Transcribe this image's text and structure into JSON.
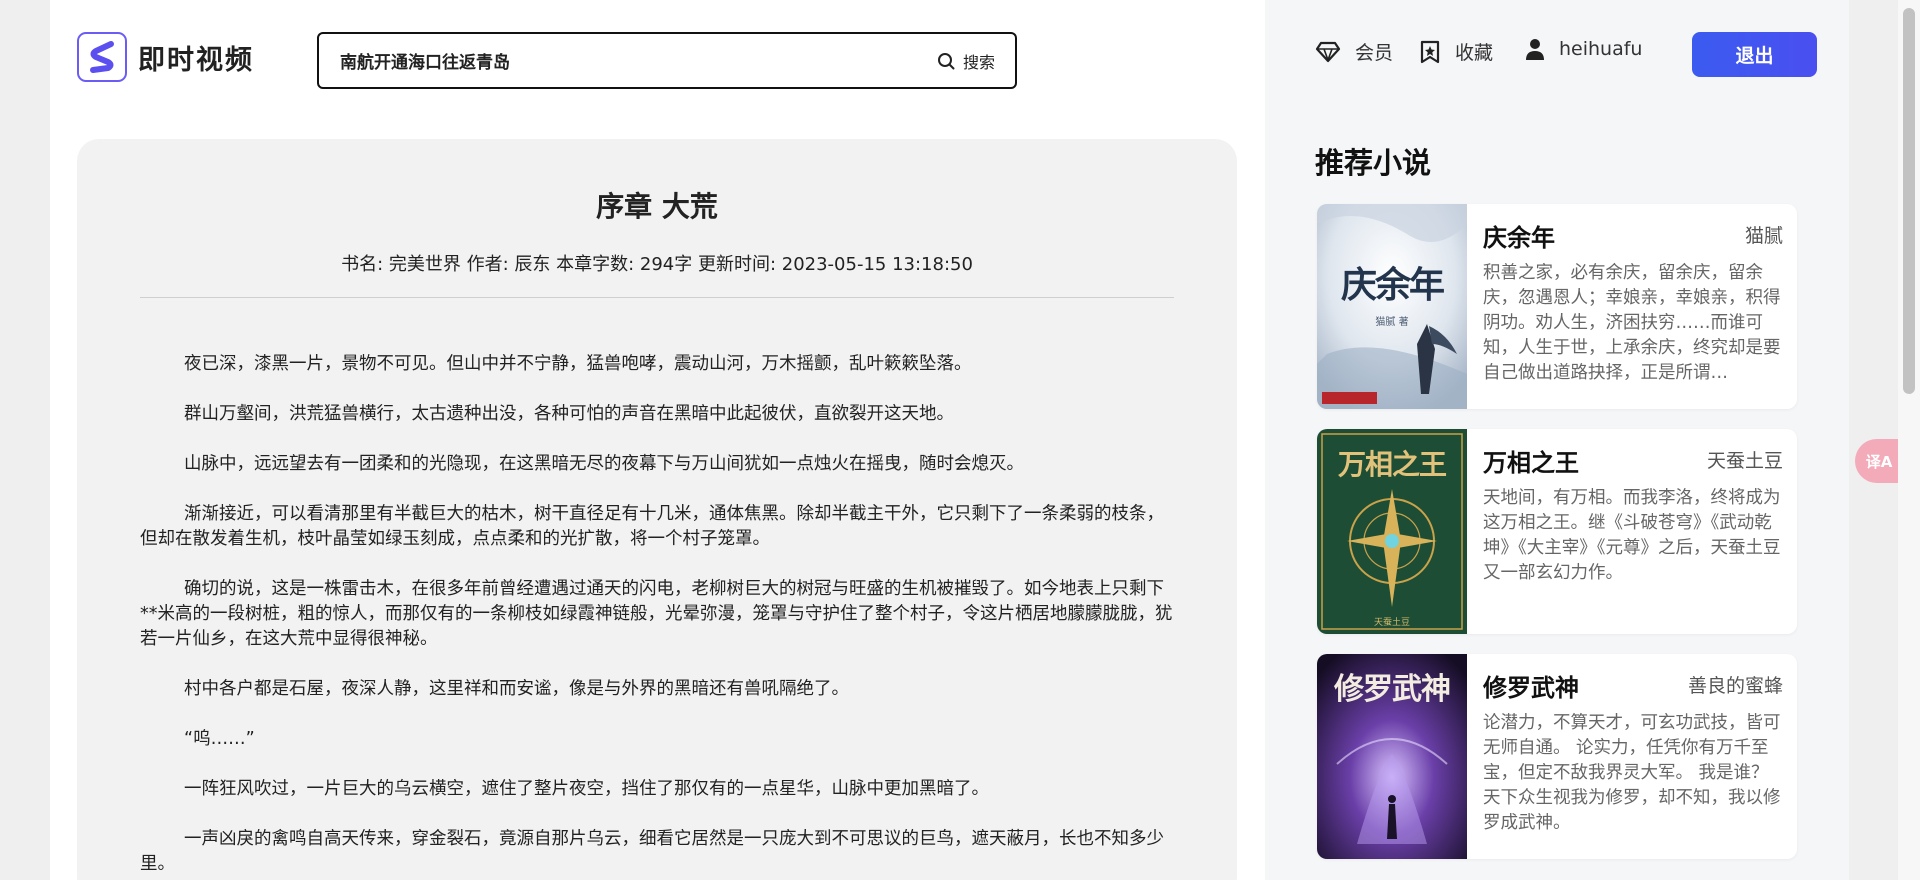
{
  "brand": {
    "name": "即时视频",
    "accent": "#6b5cf6"
  },
  "search": {
    "value": "南航开通海口往返青岛",
    "button_label": "搜索"
  },
  "header": {
    "vip_label": "会员",
    "favorites_label": "收藏",
    "username": "heihuafu",
    "logout_label": "退出"
  },
  "article": {
    "title": "序章 大荒",
    "meta": "书名: 完美世界 作者: 辰东 本章字数: 294字 更新时间: 2023-05-15 13:18:50",
    "paragraphs": [
      "夜已深，漆黑一片，景物不可见。但山中并不宁静，猛兽咆哮，震动山河，万木摇颤，乱叶簌簌坠落。",
      "群山万壑间，洪荒猛兽横行，太古遗种出没，各种可怕的声音在黑暗中此起彼伏，直欲裂开这天地。",
      "山脉中，远远望去有一团柔和的光隐现，在这黑暗无尽的夜幕下与万山间犹如一点烛火在摇曳，随时会熄灭。",
      "渐渐接近，可以看清那里有半截巨大的枯木，树干直径足有十几米，通体焦黑。除却半截主干外，它只剩下了一条柔弱的枝条，但却在散发着生机，枝叶晶莹如绿玉刻成，点点柔和的光扩散，将一个村子笼罩。",
      "确切的说，这是一株雷击木，在很多年前曾经遭遇过通天的闪电，老柳树巨大的树冠与旺盛的生机被摧毁了。如今地表上只剩下**米高的一段树桩，粗的惊人，而那仅有的一条柳枝如绿霞神链般，光晕弥漫，笼罩与守护住了整个村子，令这片栖居地朦朦胧胧，犹若一片仙乡，在这大荒中显得很神秘。",
      "村中各户都是石屋，夜深人静，这里祥和而安谧，像是与外界的黑暗还有兽吼隔绝了。",
      "“呜……”",
      "一阵狂风吹过，一片巨大的乌云横空，遮住了整片夜空，挡住了那仅有的一点星华，山脉中更加黑暗了。",
      "一声凶戾的禽鸣自高天传来，穿金裂石，竟源自那片乌云，细看它居然是一只庞大到不可思议的巨鸟，遮天蔽月，长也不知多少里。"
    ]
  },
  "recommend": {
    "title": "推荐小说",
    "books": [
      {
        "name": "庆余年",
        "author": "猫腻",
        "desc": "积善之家，必有余庆，留余庆，留余庆，忽遇恩人；幸娘亲，幸娘亲，积得阴功。劝人生，济困扶穷……而谁可知，人生于世，上承余庆，终究却是要自己做出道路抉择，正是所谓…",
        "cover_text": "庆余年",
        "cover_sub": "猫腻 著"
      },
      {
        "name": "万相之王",
        "author": "天蚕土豆",
        "desc": "天地间，有万相。而我李洛，终将成为这万相之王。继《斗破苍穹》《武动乾坤》《大主宰》《元尊》之后，天蚕土豆又一部玄幻力作。",
        "cover_text": "万相之王",
        "cover_sub": "天蚕土豆"
      },
      {
        "name": "修罗武神",
        "author": "善良的蜜蜂",
        "desc": "论潜力，不算天才，可玄功武技，皆可无师自通。 论实力，任凭你有万千至宝，但定不敌我界灵大军。 我是谁？天下众生视我为修罗，却不知，我以修罗成武神。",
        "cover_text": "修罗武神",
        "cover_sub": ""
      }
    ]
  },
  "translate_fab": "译A"
}
